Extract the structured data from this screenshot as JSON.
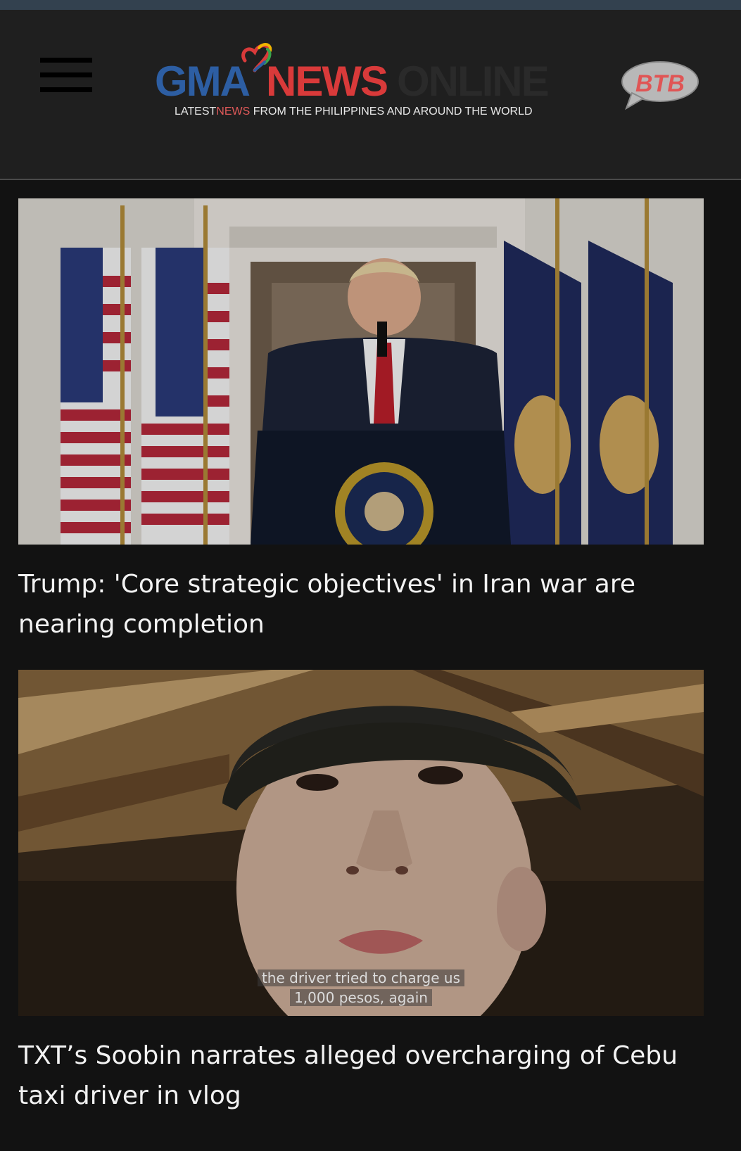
{
  "header": {
    "logo": {
      "gma": "GMA",
      "news": "NEWS",
      "online": "ONLINE"
    },
    "tagline": {
      "prefix": "LATEST",
      "highlight": "NEWS",
      "suffix": " FROM THE PHILIPPINES AND AROUND THE WORLD"
    },
    "menu_icon": "hamburger-menu-icon",
    "btb_badge": "BTB"
  },
  "articles": [
    {
      "title": "Trump: 'Core strategic objectives' in Iran war are nearing completion"
    },
    {
      "title": "TXT’s Soobin narrates alleged overcharging of Cebu taxi driver in vlog",
      "image_caption_line1": "the driver tried to charge us",
      "image_caption_line2": "1,000 pesos, again"
    }
  ],
  "colors": {
    "background": "#121212",
    "header_bg": "#1f1f1f",
    "top_strip": "#33414f",
    "gma_blue": "#2d5ea3",
    "news_red": "#d93a3a",
    "btb_red": "#e05555"
  }
}
